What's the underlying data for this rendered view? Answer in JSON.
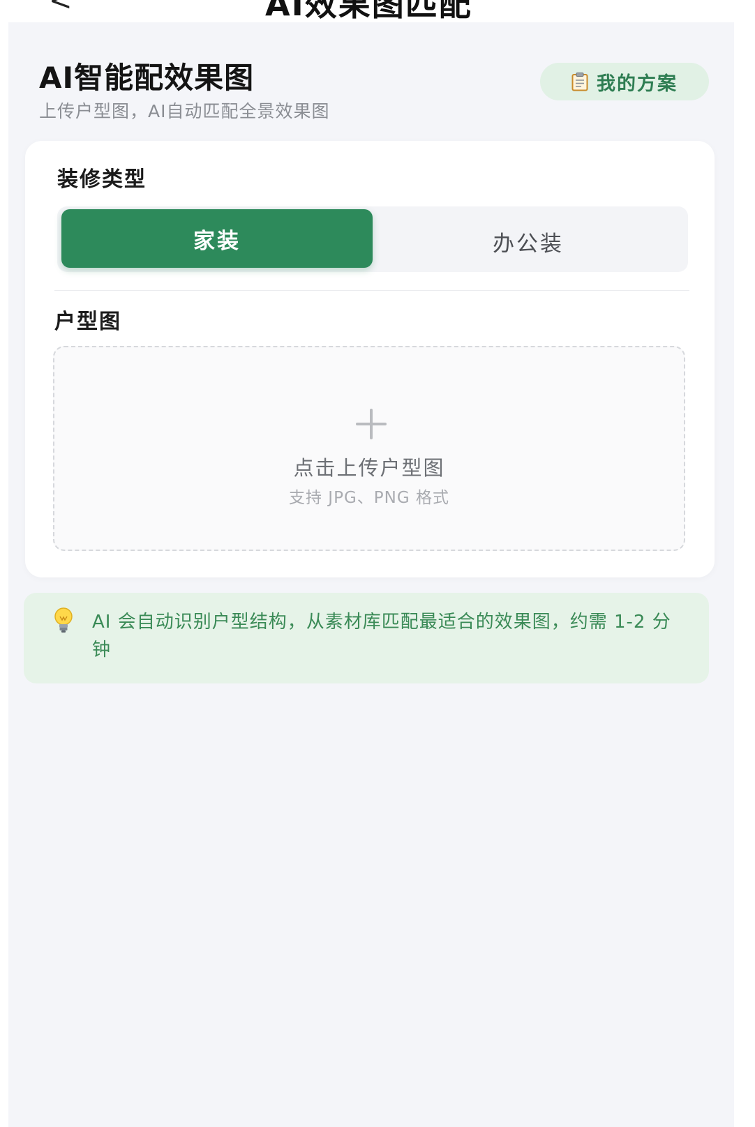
{
  "nav": {
    "back_glyph": "<",
    "title": "AI效果图匹配"
  },
  "header": {
    "title": "AI智能配效果图",
    "subtitle": "上传户型图，AI自动匹配全景效果图",
    "my_plans_label": "我的方案",
    "my_plans_icon": "clipboard-icon"
  },
  "decor_type": {
    "label": "装修类型",
    "options": [
      "家装",
      "办公装"
    ],
    "selected": "家装"
  },
  "floor_plan": {
    "label": "户型图",
    "upload_icon": "plus-icon",
    "upload_text": "点击上传户型图",
    "upload_hint": "支持 JPG、PNG 格式"
  },
  "tip": {
    "icon": "lightbulb-icon",
    "text": "AI 会自动识别户型结构，从素材库匹配最适合的效果图，约需 1-2 分钟"
  },
  "colors": {
    "primary": "#2d8a5b",
    "primary_light": "#e1f1e5",
    "page_bg": "#f4f5f9",
    "tip_bg": "#e6f3e8",
    "tip_text": "#3a8a56"
  }
}
